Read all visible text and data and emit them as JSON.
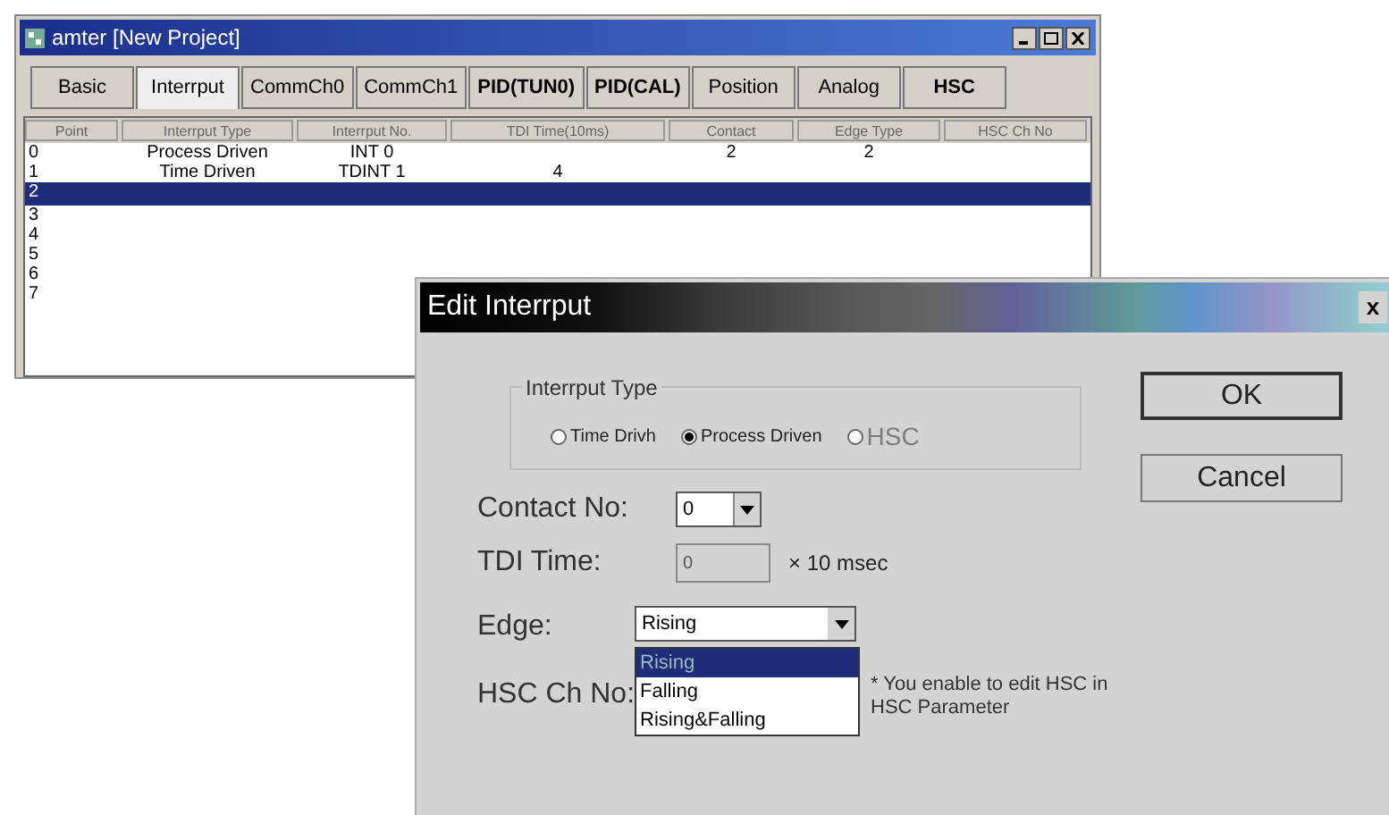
{
  "main_window": {
    "title": "amter [New Project]",
    "tabs": [
      {
        "label": "Basic",
        "selected": false
      },
      {
        "label": "Interrput",
        "selected": true
      },
      {
        "label": "CommCh0",
        "selected": false
      },
      {
        "label": "CommCh1",
        "selected": false
      },
      {
        "label": "PID(TUN0)",
        "selected": false
      },
      {
        "label": "PID(CAL)",
        "selected": false
      },
      {
        "label": "Position",
        "selected": false
      },
      {
        "label": "Analog",
        "selected": false
      },
      {
        "label": "HSC",
        "selected": false
      }
    ],
    "table": {
      "columns": [
        "Point",
        "Interrput Type",
        "Interrput No.",
        "TDI Time(10ms)",
        "Contact",
        "Edge Type",
        "HSC Ch No"
      ],
      "rows": [
        {
          "cells": [
            "0",
            "Process Driven",
            "INT 0",
            "",
            "2",
            "2",
            ""
          ],
          "selected": false
        },
        {
          "cells": [
            "1",
            "Time Driven",
            "TDINT 1",
            "4",
            "",
            "",
            ""
          ],
          "selected": false
        },
        {
          "cells": [
            "2",
            "",
            "",
            "",
            "",
            "",
            ""
          ],
          "selected": true
        },
        {
          "cells": [
            "3",
            "",
            "",
            "",
            "",
            "",
            ""
          ],
          "selected": false
        },
        {
          "cells": [
            "4",
            "",
            "",
            "",
            "",
            "",
            ""
          ],
          "selected": false
        },
        {
          "cells": [
            "5",
            "",
            "",
            "",
            "",
            "",
            ""
          ],
          "selected": false
        },
        {
          "cells": [
            "6",
            "",
            "",
            "",
            "",
            "",
            ""
          ],
          "selected": false
        },
        {
          "cells": [
            "7",
            "",
            "",
            "",
            "",
            "",
            ""
          ],
          "selected": false
        }
      ]
    }
  },
  "dialog": {
    "title": "Edit Interrput",
    "close": "x",
    "interrupt_type": {
      "label": "Interrput Type",
      "options": [
        {
          "label": "Time Drivh",
          "selected": false,
          "disabled": false
        },
        {
          "label": "Process Driven",
          "selected": true,
          "disabled": false
        },
        {
          "label": "HSC",
          "selected": false,
          "disabled": true
        }
      ]
    },
    "buttons": [
      "OK",
      "Cancel"
    ],
    "contact_no": {
      "label": "Contact No:",
      "value": "0"
    },
    "tdi_time": {
      "label": "TDI Time:",
      "value": "0",
      "disabled": true,
      "unit": "× 10 msec"
    },
    "edge": {
      "label": "Edge:",
      "value": "Rising",
      "options": [
        {
          "label": "Rising",
          "selected": true
        },
        {
          "label": "Falling",
          "selected": false
        },
        {
          "label": "Rising&Falling",
          "selected": false
        }
      ]
    },
    "hsc_ch_no": {
      "label": "HSC Ch No:",
      "note": "* You enable to edit HSC in HSC Parameter"
    }
  }
}
